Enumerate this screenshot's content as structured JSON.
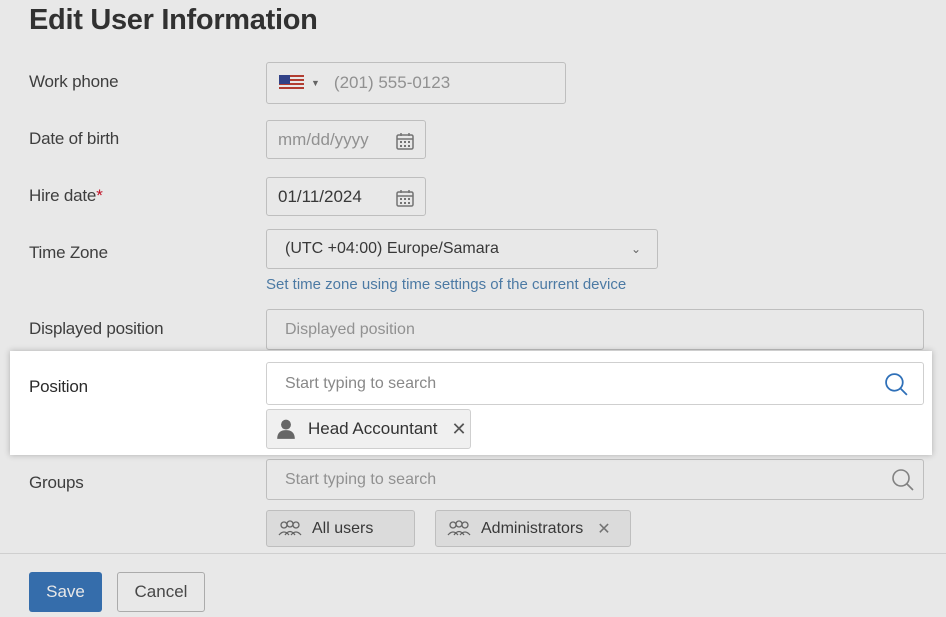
{
  "title": "Edit User Information",
  "fields": {
    "work_phone": {
      "label": "Work phone",
      "placeholder": "(201) 555-0123"
    },
    "date_of_birth": {
      "label": "Date of birth",
      "placeholder": "mm/dd/yyyy"
    },
    "hire_date": {
      "label": "Hire date",
      "required_mark": "*",
      "value": "01/11/2024"
    },
    "time_zone": {
      "label": "Time Zone",
      "value": "(UTC +04:00) Europe/Samara",
      "hint": "Set time zone using time settings of the current device"
    },
    "displayed_position": {
      "label": "Displayed position",
      "placeholder": "Displayed position"
    },
    "position": {
      "label": "Position",
      "placeholder": "Start typing to search",
      "tags": [
        {
          "label": "Head Accountant",
          "icon": "person-icon"
        }
      ]
    },
    "groups": {
      "label": "Groups",
      "placeholder": "Start typing to search",
      "tags": [
        {
          "label": "All users",
          "icon": "users-icon"
        },
        {
          "label": "Administrators",
          "icon": "users-icon"
        }
      ]
    }
  },
  "footer": {
    "save_label": "Save",
    "cancel_label": "Cancel"
  },
  "colors": {
    "accent": "#2f70b8",
    "required": "#d0021b",
    "hint": "#4a7fb0"
  }
}
